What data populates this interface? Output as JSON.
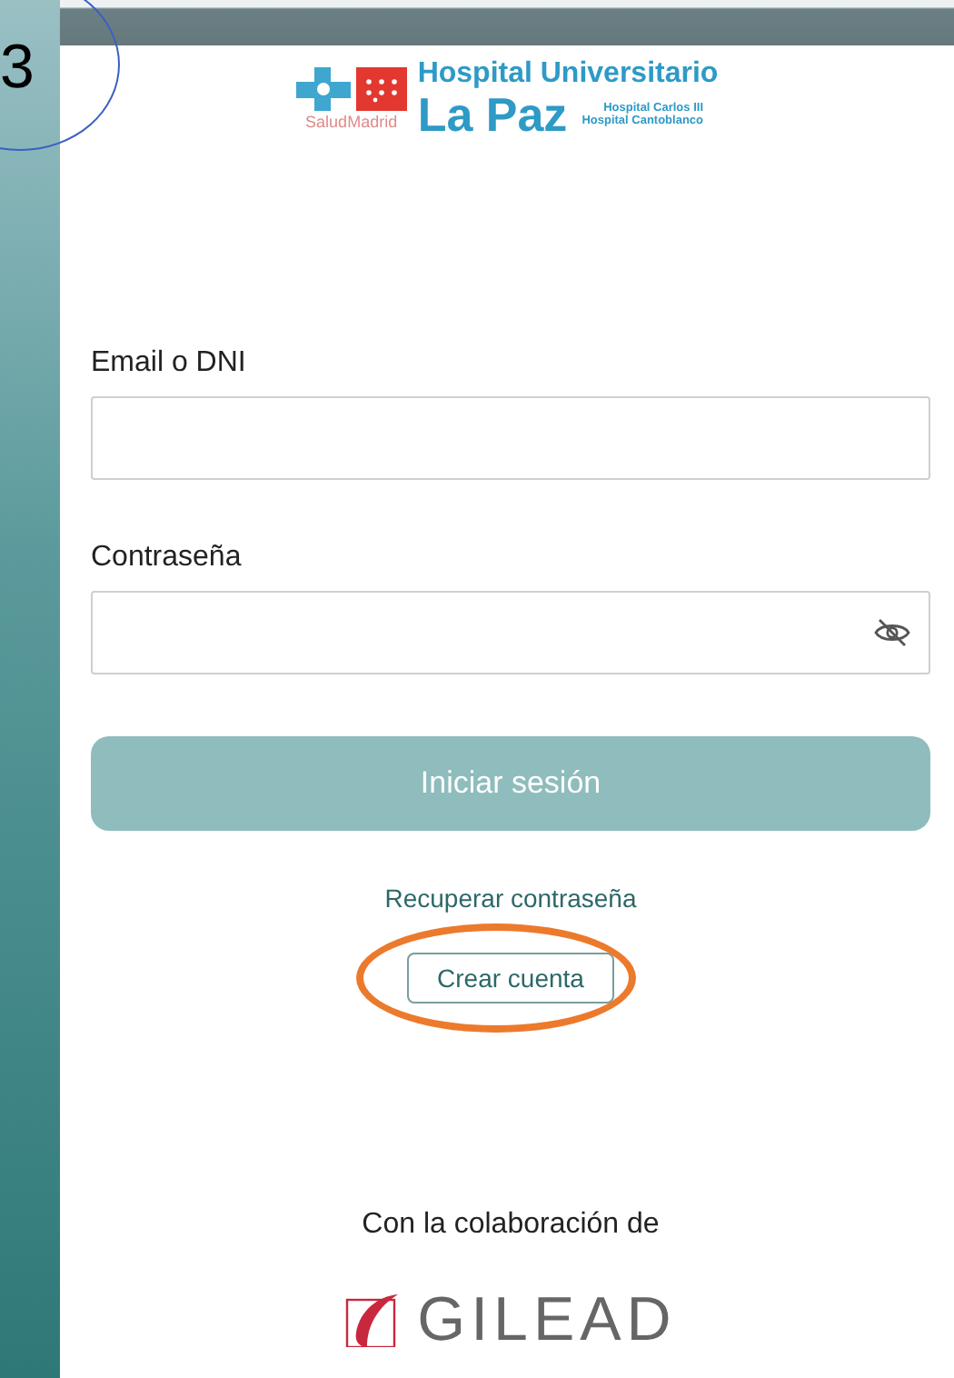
{
  "slide_number": "3",
  "header": {
    "brand": "SaludMadrid",
    "title": "Hospital Universitario",
    "subtitle": "La Paz",
    "affiliates": [
      "Hospital Carlos III",
      "Hospital Cantoblanco"
    ]
  },
  "fields": [
    {
      "label": "Email o DNI",
      "kind": "text"
    },
    {
      "label": "Contraseña",
      "kind": "password"
    }
  ],
  "login_button": {
    "label": "Iniciar sesión",
    "disabled": true
  },
  "recover_link": "Recuperar contraseña",
  "create_button": {
    "label": "Crear cuenta",
    "highlighted": true
  },
  "footer": {
    "caption": "Con la colaboración de",
    "sponsor": "GILEAD"
  }
}
